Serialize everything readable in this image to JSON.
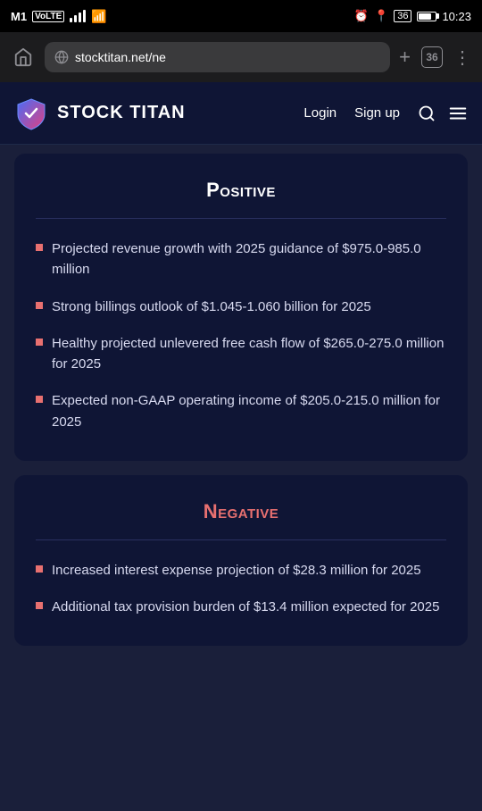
{
  "statusBar": {
    "carrier": "M1",
    "carrierType": "VoLTE",
    "time": "10:23",
    "tabCount": "36"
  },
  "browser": {
    "url": "stocktitan.net/ne",
    "homeLabel": "⌂",
    "newTabLabel": "+",
    "menuLabel": "⋯"
  },
  "header": {
    "title": "STOCK TITAN",
    "loginLabel": "Login",
    "signupLabel": "Sign up"
  },
  "positive": {
    "sectionTitle": "Positive",
    "divider": true,
    "bullets": [
      "Projected revenue growth with 2025 guidance of $975.0-985.0 million",
      "Strong billings outlook of $1.045-1.060 billion for 2025",
      "Healthy projected unlevered free cash flow of $265.0-275.0 million for 2025",
      "Expected non-GAAP operating income of $205.0-215.0 million for 2025"
    ]
  },
  "negative": {
    "sectionTitle": "Negative",
    "divider": true,
    "bullets": [
      "Increased interest expense projection of $28.3 million for 2025",
      "Additional tax provision burden of $13.4 million expected for 2025"
    ]
  }
}
